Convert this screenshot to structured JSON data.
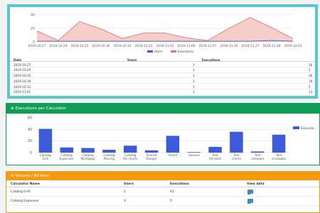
{
  "top_chart": {
    "chart_data": {
      "type": "area",
      "x": [
        "2019-10-27",
        "2019-10-29",
        "2019-10-25",
        "2019-10-30",
        "2019-10-31",
        "2019-11-01",
        "2019-11-05",
        "2019-11-06",
        "2019-11-07",
        "2019-11-26",
        "2019-11-27",
        "2019-11-29",
        "2019-12-03"
      ],
      "series": [
        {
          "name": "Users",
          "values": [
            1,
            1,
            1,
            1,
            1,
            1,
            1,
            1,
            1,
            1,
            1,
            2,
            1
          ],
          "color": "#3b5bdb"
        },
        {
          "name": "Executions",
          "values": [
            16,
            2,
            30,
            19,
            5,
            13,
            13,
            6,
            2,
            20,
            36,
            21,
            5
          ],
          "color": "#e57373"
        }
      ],
      "ylim": [
        0,
        45
      ],
      "yticks": [
        0,
        20,
        40
      ],
      "legend": "bottom-center"
    }
  },
  "top_table": {
    "headers": {
      "date": "Date",
      "users": "Users",
      "executions": "Executions"
    },
    "rows": [
      {
        "date": "2019-10-27",
        "users": "1",
        "executions": "16"
      },
      {
        "date": "2019-10-29",
        "users": "1",
        "executions": "2"
      },
      {
        "date": "2019-10-25",
        "users": "1",
        "executions": "30"
      },
      {
        "date": "2019-10-30",
        "users": "1",
        "executions": "19"
      },
      {
        "date": "2019-10-31",
        "users": "1",
        "executions": "5"
      },
      {
        "date": "2019-11-01",
        "users": "1",
        "executions": "13"
      },
      {
        "date": "2019-11-05",
        "users": "1",
        "executions": "13"
      }
    ]
  },
  "exec_panel": {
    "title": "Executions per Calculator",
    "chart_data": {
      "type": "bar",
      "categories": [
        "Catalog Grill",
        "Catalog Expenses",
        "Catalog Mortgage",
        "Catalog Moving",
        "Catalog Pie charts",
        "Scored Ranges",
        "Invest",
        "Lessons",
        "Test Alt-tests",
        "Test charts",
        "Test compare",
        "Test scrollable"
      ],
      "series": [
        {
          "name": "Executio...",
          "values": [
            41,
            9,
            8,
            5,
            12,
            4,
            29,
            1,
            10,
            36,
            2,
            31
          ],
          "color": "#3b5bdb"
        }
      ],
      "ylim": [
        0,
        60
      ],
      "yticks": [
        0,
        20,
        40,
        60
      ],
      "legend": "top-right"
    }
  },
  "volume_panel": {
    "title": "Volume / All time",
    "headers": {
      "name": "Calculator Name",
      "users": "Users",
      "executions": "Executions",
      "view": "View data"
    },
    "rows": [
      {
        "name": "Catalog Grill",
        "users": "2",
        "executions": "41"
      },
      {
        "name": "Catalog Expenses",
        "users": "3",
        "executions": "5"
      }
    ],
    "view_icon": "eye-icon"
  }
}
